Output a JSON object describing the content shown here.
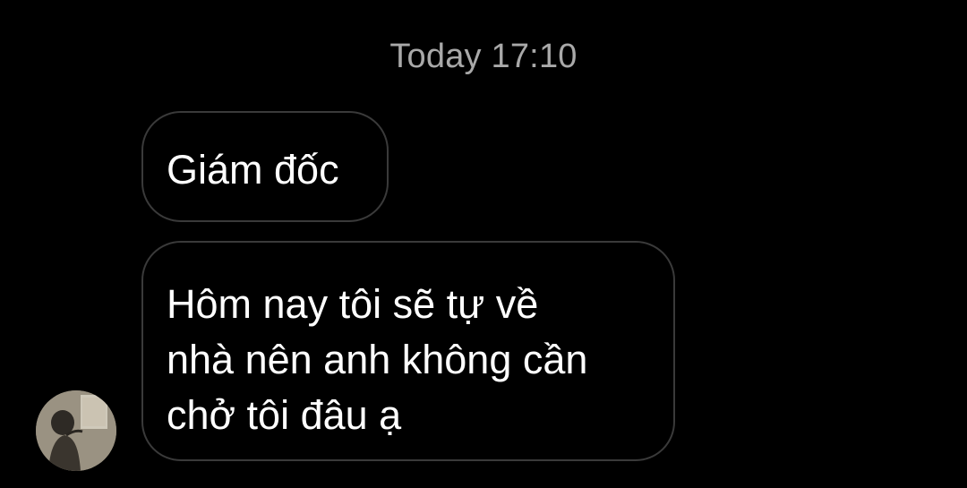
{
  "chat": {
    "timestamp": "Today 17:10",
    "messages": [
      {
        "lines": [
          "Giám đốc"
        ]
      },
      {
        "lines": [
          "Hôm nay tôi sẽ tự về",
          "nhà nên anh không cần",
          "chở tôi đâu ạ"
        ]
      }
    ]
  },
  "colors": {
    "background": "#000000",
    "bubble_border": "#3a3a3a",
    "timestamp_text": "#a9a9a9",
    "message_text": "#ffffff"
  },
  "icons": {
    "avatar": "contact-avatar-photo"
  }
}
